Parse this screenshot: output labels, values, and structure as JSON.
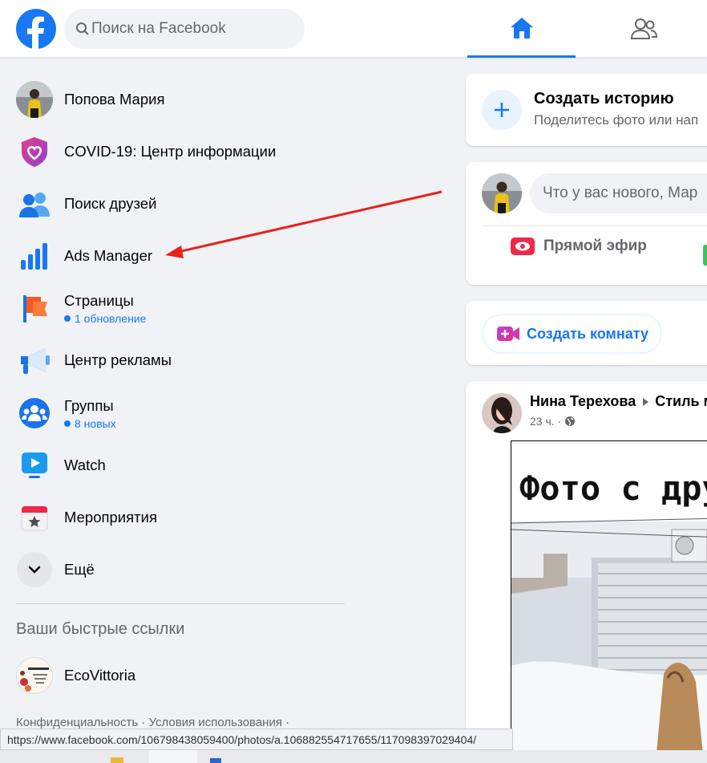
{
  "header": {
    "search_placeholder": "Поиск на Facebook"
  },
  "sidebar": {
    "items": [
      {
        "label": "Попова Мария",
        "sub": ""
      },
      {
        "label": "COVID-19: Центр информации",
        "sub": ""
      },
      {
        "label": "Поиск друзей",
        "sub": ""
      },
      {
        "label": "Ads Manager",
        "sub": ""
      },
      {
        "label": "Страницы",
        "sub": "1 обновление"
      },
      {
        "label": "Центр рекламы",
        "sub": ""
      },
      {
        "label": "Группы",
        "sub": "8 новых"
      },
      {
        "label": "Watch",
        "sub": ""
      },
      {
        "label": "Мероприятия",
        "sub": ""
      },
      {
        "label": "Ещё",
        "sub": ""
      }
    ],
    "quick_links_title": "Ваши быстрые ссылки",
    "quick_links": [
      {
        "label": "EcoVittoria"
      }
    ],
    "footer": "Конфиденциальность · Условия использования ·"
  },
  "feed": {
    "story": {
      "title": "Создать историю",
      "subtitle": "Поделитесь фото или нап"
    },
    "composer": {
      "placeholder": "Что у вас нового, Мар",
      "live_label": "Прямой эфир"
    },
    "room": {
      "label": "Создать комнату"
    },
    "post": {
      "author": "Нина Терехова",
      "group": "Стиль м",
      "time": "23 ч. ·",
      "image_caption": "Фото с дру"
    }
  },
  "status_bar": {
    "url": "https://www.facebook.com/106798438059400/photos/a.106882554717655/117098397029404/"
  },
  "colors": {
    "accent": "#1877f2",
    "background": "#f0f2f5",
    "annotation_arrow": "#e8211b"
  }
}
